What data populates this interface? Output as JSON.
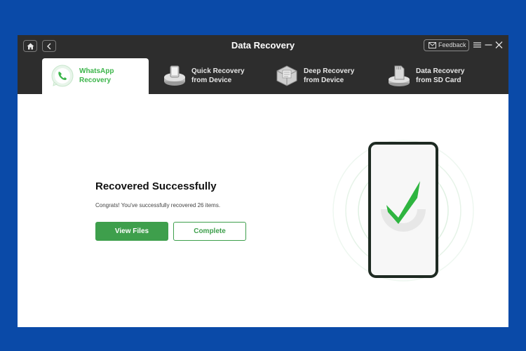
{
  "window": {
    "title": "Data Recovery"
  },
  "titlebar": {
    "feedback_label": "Feedback",
    "icons": [
      "home-icon",
      "back-arrow-icon",
      "mail-icon",
      "menu-icon",
      "minimize-icon",
      "close-icon"
    ]
  },
  "tabs": [
    {
      "label": "WhatsApp\nRecovery",
      "icon": "whatsapp-phone-icon",
      "active": true
    },
    {
      "label": "Quick Recovery\nfrom Device",
      "icon": "device-drive-icon",
      "active": false
    },
    {
      "label": "Deep Recovery\nfrom Device",
      "icon": "deep-scan-icon",
      "active": false
    },
    {
      "label": "Data Recovery\nfrom SD Card",
      "icon": "sd-card-icon",
      "active": false
    }
  ],
  "result": {
    "headline": "Recovered Successfully",
    "message": "Congrats! You've successfully recovered 26 items.",
    "view_files_label": "View Files",
    "complete_label": "Complete"
  },
  "colors": {
    "accent": "#3e9f4c",
    "titlebar": "#2d2d2d",
    "page_background": "#0a4aa8",
    "check": "#2fb540"
  },
  "illustration": {
    "icon": "phone-checkmark-icon"
  }
}
